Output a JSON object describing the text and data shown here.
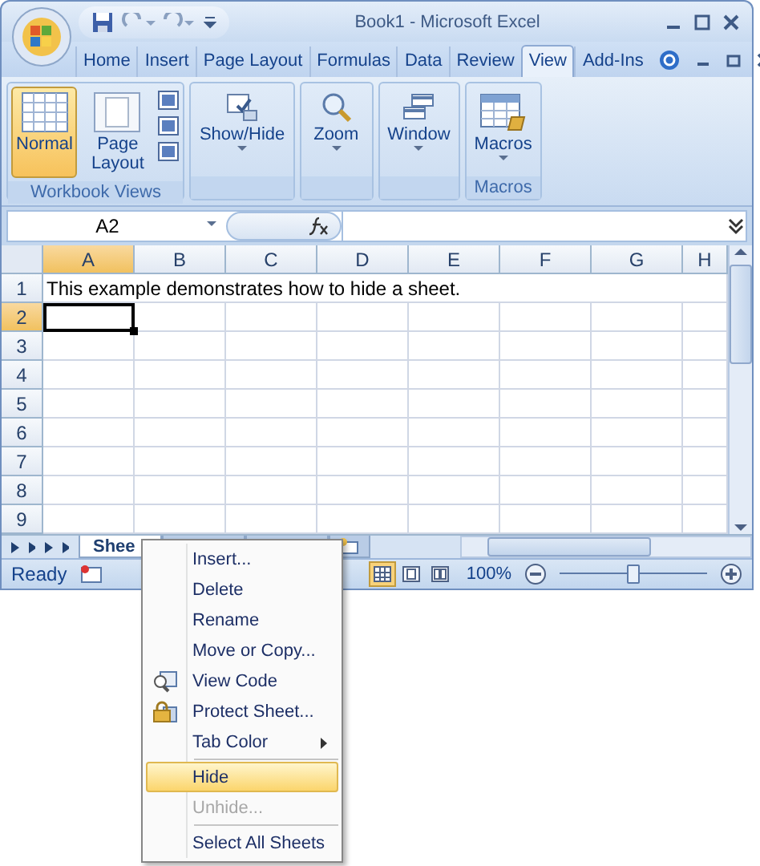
{
  "window": {
    "title": "Book1 - Microsoft Excel"
  },
  "ribbon_tabs": [
    {
      "label": "Home",
      "selected": false
    },
    {
      "label": "Insert",
      "selected": false
    },
    {
      "label": "Page Layout",
      "selected": false
    },
    {
      "label": "Formulas",
      "selected": false
    },
    {
      "label": "Data",
      "selected": false
    },
    {
      "label": "Review",
      "selected": false
    },
    {
      "label": "View",
      "selected": true
    },
    {
      "label": "Add-Ins",
      "selected": false
    }
  ],
  "ribbon_groups": [
    {
      "label": "Workbook Views",
      "buttons": [
        {
          "kind": "normal",
          "label": "Normal",
          "selected": true,
          "dropdown": false
        },
        {
          "kind": "page-layout",
          "label": "Page Layout",
          "selected": false,
          "dropdown": false
        },
        {
          "kind": "small"
        },
        {
          "kind": "small"
        },
        {
          "kind": "small"
        }
      ]
    },
    {
      "buttons": [
        {
          "kind": "show-hide",
          "label": "Show/Hide",
          "selected": false,
          "dropdown": true
        }
      ]
    },
    {
      "buttons": [
        {
          "kind": "zoom",
          "label": "Zoom",
          "selected": false,
          "dropdown": true
        }
      ]
    },
    {
      "buttons": [
        {
          "kind": "window",
          "label": "Window",
          "selected": false,
          "dropdown": true
        }
      ]
    },
    {
      "label": "Macros",
      "buttons": [
        {
          "kind": "macros",
          "label": "Macros",
          "selected": false,
          "dropdown": true
        }
      ]
    }
  ],
  "formula_bar": {
    "name_box": "A2"
  },
  "grid": {
    "columns": [
      {
        "label": "A",
        "selected": true
      },
      {
        "label": "B",
        "selected": false
      },
      {
        "label": "C",
        "selected": false
      },
      {
        "label": "D",
        "selected": false
      },
      {
        "label": "E",
        "selected": false
      },
      {
        "label": "F",
        "selected": false
      },
      {
        "label": "G",
        "selected": false
      },
      {
        "label": "H",
        "selected": false
      }
    ],
    "rows": [
      {
        "label": "1",
        "selected": false,
        "text": "This example demonstrates how to hide a sheet."
      },
      {
        "label": "2",
        "selected": true
      },
      {
        "label": "3",
        "selected": false
      },
      {
        "label": "4",
        "selected": false
      },
      {
        "label": "5",
        "selected": false
      },
      {
        "label": "6",
        "selected": false
      },
      {
        "label": "7",
        "selected": false
      },
      {
        "label": "8",
        "selected": false
      },
      {
        "label": "9",
        "selected": false
      }
    ]
  },
  "sheet_tabs": [
    {
      "kind": "sheet",
      "label": "Shee",
      "selected": true
    },
    {
      "kind": "sheet",
      "selected": false
    },
    {
      "kind": "sheet",
      "selected": false
    },
    {
      "kind": "insert"
    }
  ],
  "status_bar": {
    "text": "Ready",
    "views": [
      {
        "selected": true
      },
      {
        "selected": false
      },
      {
        "selected": false
      }
    ],
    "zoom": "100%",
    "zoom_slider": {
      "level": 0.5
    }
  },
  "context_menu": {
    "items": [
      {
        "label": "Insert...",
        "kind": "plain",
        "disabled": false,
        "selected": false,
        "separator_before": false
      },
      {
        "label": "Delete",
        "kind": "plain",
        "disabled": false,
        "selected": false,
        "separator_before": false
      },
      {
        "label": "Rename",
        "kind": "plain",
        "disabled": false,
        "selected": false,
        "separator_before": false
      },
      {
        "label": "Move or Copy...",
        "kind": "plain",
        "disabled": false,
        "selected": false,
        "separator_before": false
      },
      {
        "label": "View Code",
        "kind": "code",
        "disabled": false,
        "selected": false,
        "separator_before": false
      },
      {
        "label": "Protect Sheet...",
        "kind": "lock",
        "disabled": false,
        "selected": false,
        "separator_before": false
      },
      {
        "label": "Tab Color",
        "kind": "submenu",
        "disabled": false,
        "selected": false,
        "separator_before": false
      },
      {
        "label": "Hide",
        "kind": "plain",
        "disabled": false,
        "selected": true,
        "separator_before": true
      },
      {
        "label": "Unhide...",
        "kind": "plain",
        "disabled": true,
        "selected": false,
        "separator_before": false
      },
      {
        "label": "Select All Sheets",
        "kind": "plain",
        "disabled": false,
        "selected": false,
        "separator_before": true
      }
    ]
  }
}
